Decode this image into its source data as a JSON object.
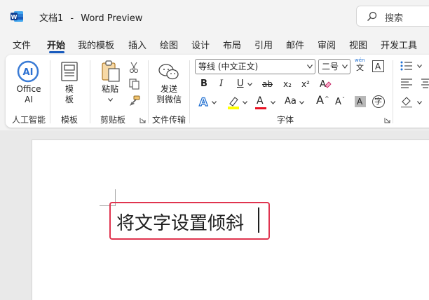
{
  "titlebar": {
    "doc_name": "文档1",
    "separator": "-",
    "app_name": "Word Preview",
    "search_placeholder": "搜索"
  },
  "tabs": [
    {
      "label": "文件",
      "active": false
    },
    {
      "label": "开始",
      "active": true
    },
    {
      "label": "我的模板",
      "active": false
    },
    {
      "label": "插入",
      "active": false
    },
    {
      "label": "绘图",
      "active": false
    },
    {
      "label": "设计",
      "active": false
    },
    {
      "label": "布局",
      "active": false
    },
    {
      "label": "引用",
      "active": false
    },
    {
      "label": "邮件",
      "active": false
    },
    {
      "label": "审阅",
      "active": false
    },
    {
      "label": "视图",
      "active": false
    },
    {
      "label": "开发工具",
      "active": false
    }
  ],
  "ribbon": {
    "office_ai": {
      "line1": "Office",
      "line2": "AI",
      "group": "人工智能"
    },
    "template": {
      "line1": "模",
      "line2": "板",
      "group": "模板"
    },
    "clipboard": {
      "paste": "粘贴",
      "group": "剪贴板"
    },
    "file_transfer": {
      "line1": "发送",
      "line2": "到微信",
      "group": "文件传输"
    },
    "font": {
      "name": "等线 (中文正文)",
      "size": "二号",
      "phonetic_top": "wén",
      "phonetic_bottom": "文",
      "group": "字体",
      "buttons": {
        "bold": "B",
        "italic": "I",
        "underline": "U",
        "strike": "ab",
        "subscript": "x₂",
        "superscript": "x²",
        "font_color": "A",
        "change_case": "Aa",
        "grow": "A",
        "shrink": "A",
        "char_shading": "A",
        "enclose": "字",
        "border_char": "A"
      }
    }
  },
  "document": {
    "text": "将文字设置倾斜"
  },
  "colors": {
    "accent": "#185abd",
    "highlight_border": "#e0344f",
    "font_color_bar": "#e81123",
    "highlighter_bar": "#ffff00"
  }
}
